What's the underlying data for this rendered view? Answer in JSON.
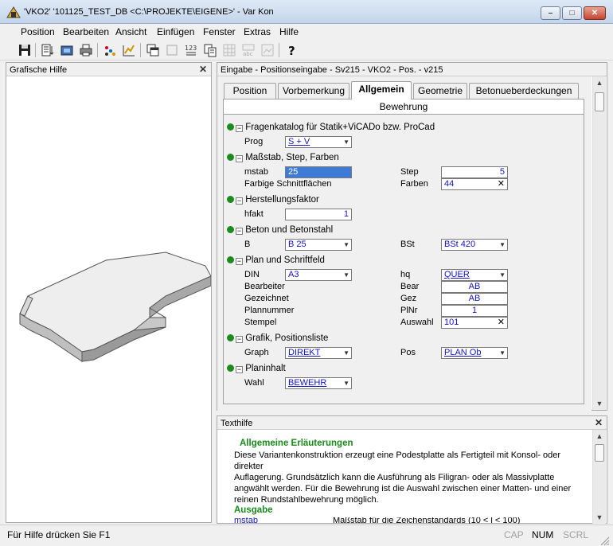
{
  "window": {
    "title": "'VKO2' '101125_TEST_DB <C:\\PROJEKTE\\EIGENE>' - Var Kon",
    "controls": {
      "minimize": "–",
      "maximize": "□",
      "close": "✕"
    }
  },
  "menu": [
    "Position",
    "Bearbeiten",
    "Ansicht",
    "Einfügen",
    "Fenster",
    "Extras",
    "Hilfe"
  ],
  "toolbar_icons": [
    "save-icon",
    "list-icon",
    "database-icon",
    "print-icon",
    "dots-icon",
    "chart-icon",
    "copy-window-icon",
    "window-icon",
    "numbering-icon",
    "document-icon",
    "grid-icon",
    "abc-icon",
    "image-icon",
    "help-icon"
  ],
  "left_panel": {
    "title": "Grafische Hilfe",
    "close": "✕"
  },
  "right_panel": {
    "title": "Eingabe - Positionseingabe - Sv215 - VKO2 - Pos. - v215",
    "tabs": [
      "Position",
      "Vorbemerkung",
      "Allgemein",
      "Geometrie",
      "Betonueberdeckungen"
    ],
    "active_tab": "Allgemein",
    "subtab": "Bewehrung",
    "sections": {
      "fragen": {
        "title": "Fragenkatalog für Statik+ViCADo bzw. ProCad",
        "prog_label": "Prog",
        "prog_value": "S + V"
      },
      "massstab": {
        "title": "Maßstab, Step, Farben",
        "mstab_label": "mstab",
        "mstab_value": "25",
        "step_label": "Step",
        "step_value": "5",
        "farbige_label": "Farbige Schnittflächen",
        "farben_label": "Farben",
        "farben_value": "44",
        "farben_clear": "✕"
      },
      "herstellung": {
        "title": "Herstellungsfaktor",
        "hfakt_label": "hfakt",
        "hfakt_value": "1"
      },
      "beton": {
        "title": "Beton und Betonstahl",
        "b_label": "B",
        "b_value": "B 25",
        "bst_label": "BSt",
        "bst_value": "BSt 420"
      },
      "plan": {
        "title": "Plan und Schriftfeld",
        "din_label": "DIN",
        "din_value": "A3",
        "hq_label": "hq",
        "hq_value": "QUER",
        "bearbeiter_label": "Bearbeiter",
        "bear_label": "Bear",
        "bear_value": "AB",
        "gezeichnet_label": "Gezeichnet",
        "gez_label": "Gez",
        "gez_value": "AB",
        "plannummer_label": "Plannummer",
        "plnr_label": "PlNr",
        "plnr_value": "1",
        "stempel_label": "Stempel",
        "auswahl_label": "Auswahl",
        "auswahl_value": "101",
        "auswahl_clear": "✕"
      },
      "grafik": {
        "title": "Grafik, Positionsliste",
        "graph_label": "Graph",
        "graph_value": "DIREKT",
        "pos_label": "Pos",
        "pos_value": "PLAN Ob"
      },
      "planinhalt": {
        "title": "Planinhalt",
        "wahl_label": "Wahl",
        "wahl_value": "BEWEHR"
      }
    }
  },
  "text_panel": {
    "title": "Texthilfe",
    "close": "✕",
    "heading": "Allgemeine Erläuterungen",
    "paragraph_lines": [
      "Diese Variantenkonstruktion erzeugt eine Podestplatte als Fertigteil mit Konsol- oder direkter",
      "Auflagerung.  Grundsätzlich kann die Ausführung als Filigran- oder als Massivplatte",
      "angwählt werden. Für die Bewehrung ist die Auswahl zwischen einer Matten- und einer",
      "reinen Rundstahlbewehrung möglich."
    ],
    "heading2": "Ausgabe",
    "row_label": "mstab",
    "row_text": "Maßstab für die Zeichenstandards (10 < l < 100)"
  },
  "statusbar": {
    "hint": "Für Hilfe drücken Sie F1",
    "cap": "CAP",
    "num": "NUM",
    "scrl": "SCRL"
  },
  "colors": {
    "value_blue": "#1414c8",
    "dot_green": "#1c8a1c",
    "help_green": "#1a8a1a"
  }
}
